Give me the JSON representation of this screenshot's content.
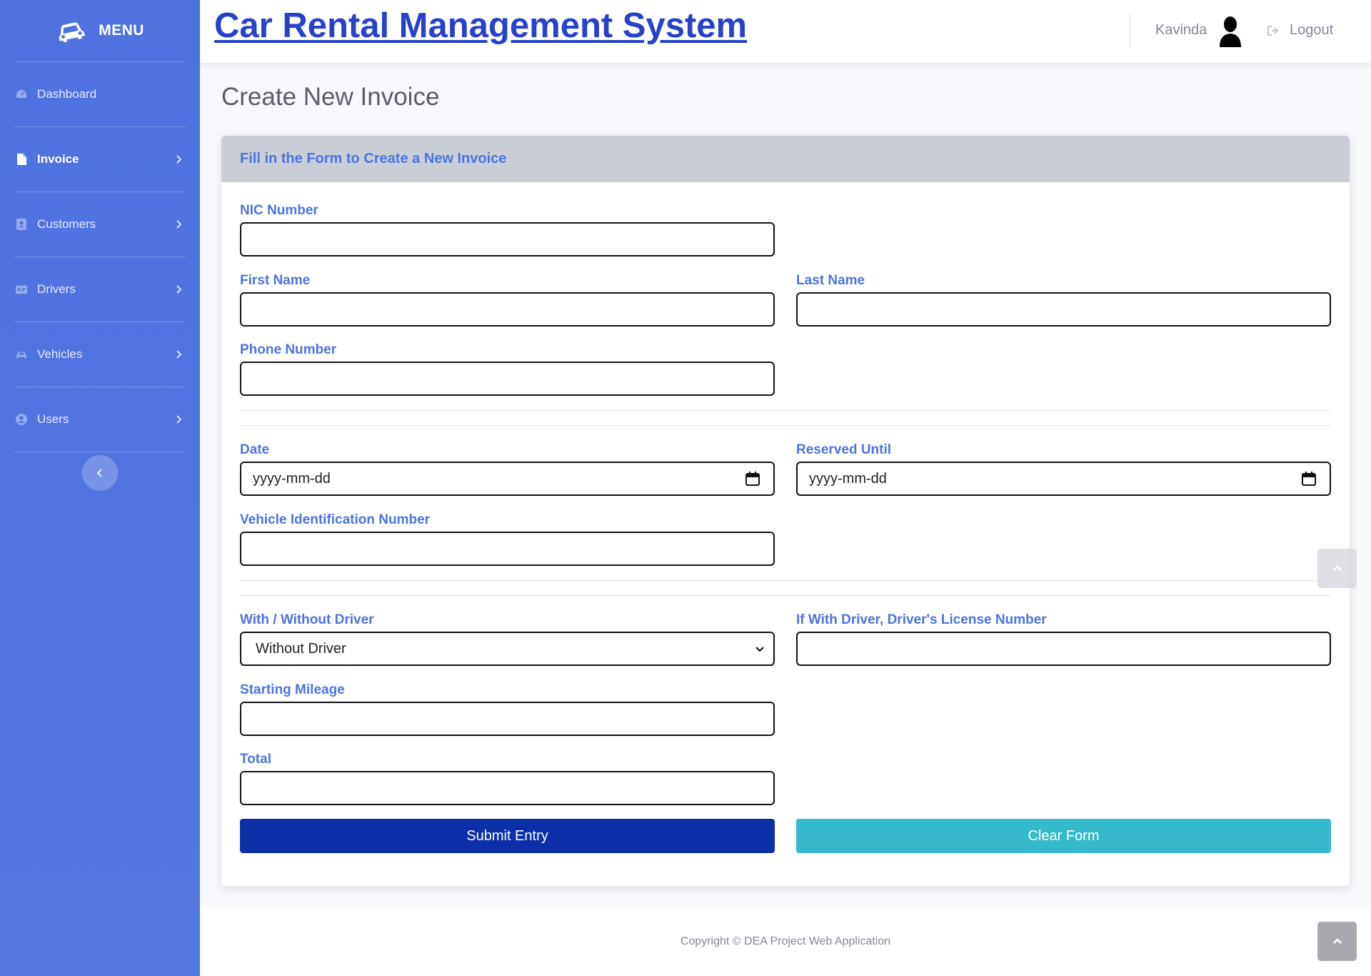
{
  "sidebar": {
    "brand": "MENU",
    "items": [
      {
        "label": "Dashboard",
        "icon": "dashboard-icon"
      },
      {
        "label": "Invoice",
        "icon": "file-icon"
      },
      {
        "label": "Customers",
        "icon": "address-book-icon"
      },
      {
        "label": "Drivers",
        "icon": "id-card-icon"
      },
      {
        "label": "Vehicles",
        "icon": "car-icon"
      },
      {
        "label": "Users",
        "icon": "user-circle-icon"
      }
    ],
    "active_item": "Invoice"
  },
  "topbar": {
    "title": "Car Rental Management System",
    "user_name": "Kavinda",
    "logout_label": "Logout"
  },
  "page": {
    "title": "Create New Invoice"
  },
  "form": {
    "header": "Fill in the Form to Create a New Invoice",
    "nic_label": "NIC Number",
    "nic_value": "",
    "first_name_label": "First Name",
    "first_name_value": "",
    "last_name_label": "Last Name",
    "last_name_value": "",
    "phone_label": "Phone Number",
    "phone_value": "",
    "date_label": "Date",
    "date_value": "yyyy-mm-dd",
    "reserved_until_label": "Reserved Until",
    "reserved_until_value": "yyyy-mm-dd",
    "vin_label": "Vehicle Identification Number",
    "vin_value": "",
    "driver_option_label": "With / Without Driver",
    "driver_option_selected": "Without Driver",
    "license_label": "If With Driver, Driver's License Number",
    "license_value": "",
    "mileage_label": "Starting Mileage",
    "mileage_value": "",
    "total_label": "Total",
    "total_value": "",
    "submit_label": "Submit Entry",
    "clear_label": "Clear Form"
  },
  "footer": {
    "copyright": "Copyright © DEA Project Web Application"
  },
  "colors": {
    "sidebar": "#4e73df",
    "label": "#4e73df",
    "title": "#2742c9",
    "submit": "#0a2fa6",
    "clear": "#36b9cc",
    "card_header": "#c8cdd6"
  }
}
